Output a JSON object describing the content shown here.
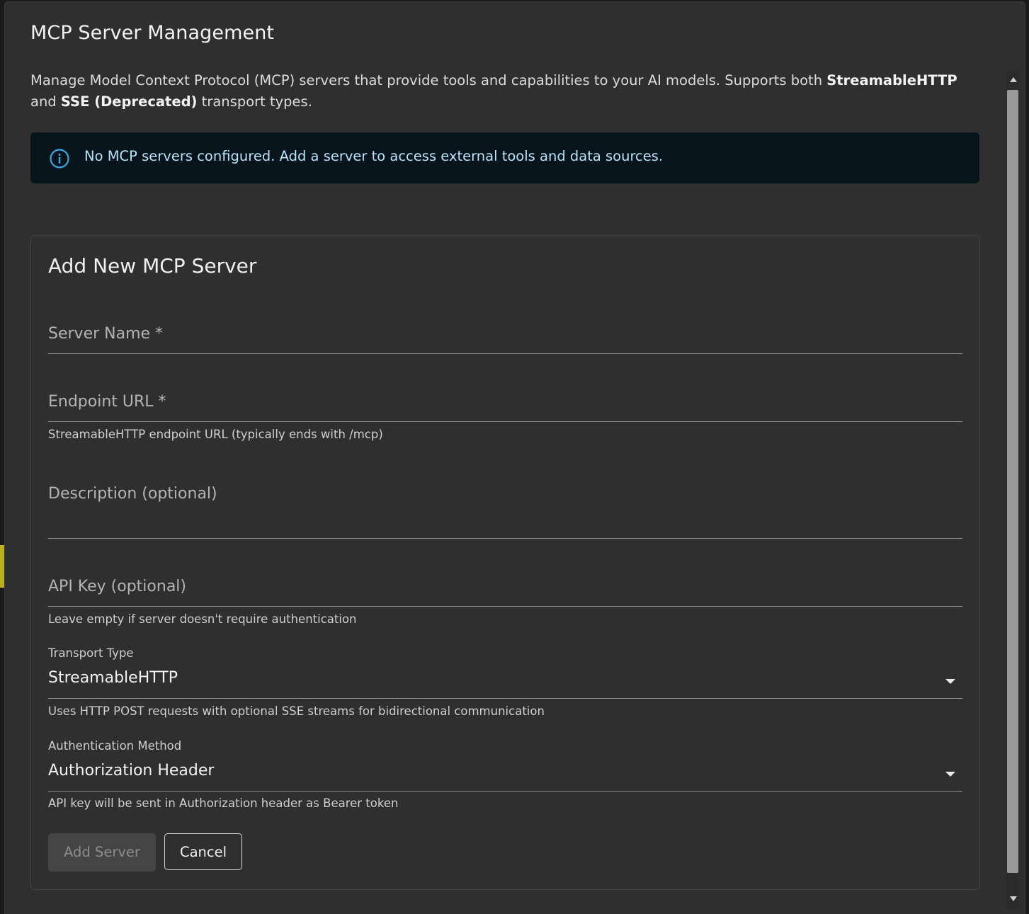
{
  "dialog": {
    "title": "MCP Server Management",
    "description_prefix": "Manage Model Context Protocol (MCP) servers that provide tools and capabilities to your AI models. Supports both ",
    "description_bold_1": "StreamableHTTP",
    "description_mid": " and ",
    "description_bold_2": "SSE (Deprecated)",
    "description_suffix": " transport types."
  },
  "alert": {
    "icon": "info-icon",
    "text": "No MCP servers configured. Add a server to access external tools and data sources."
  },
  "form": {
    "title": "Add New MCP Server",
    "server_name": {
      "label": "Server Name *",
      "value": ""
    },
    "endpoint_url": {
      "label": "Endpoint URL *",
      "value": "",
      "helper": "StreamableHTTP endpoint URL (typically ends with /mcp)"
    },
    "description": {
      "label": "Description (optional)",
      "value": ""
    },
    "api_key": {
      "label": "API Key (optional)",
      "value": "",
      "helper": "Leave empty if server doesn't require authentication"
    },
    "transport_type": {
      "label": "Transport Type",
      "value": "StreamableHTTP",
      "helper": "Uses HTTP POST requests with optional SSE streams for bidirectional communication"
    },
    "auth_method": {
      "label": "Authentication Method",
      "value": "Authorization Header",
      "helper": "API key will be sent in Authorization header as Bearer token"
    },
    "buttons": {
      "add": "Add Server",
      "cancel": "Cancel"
    }
  },
  "colors": {
    "dialog_bg": "#2f2f2f",
    "alert_bg": "#07141c",
    "alert_text": "#b7e3f6",
    "alert_icon": "#3aa7e0"
  }
}
